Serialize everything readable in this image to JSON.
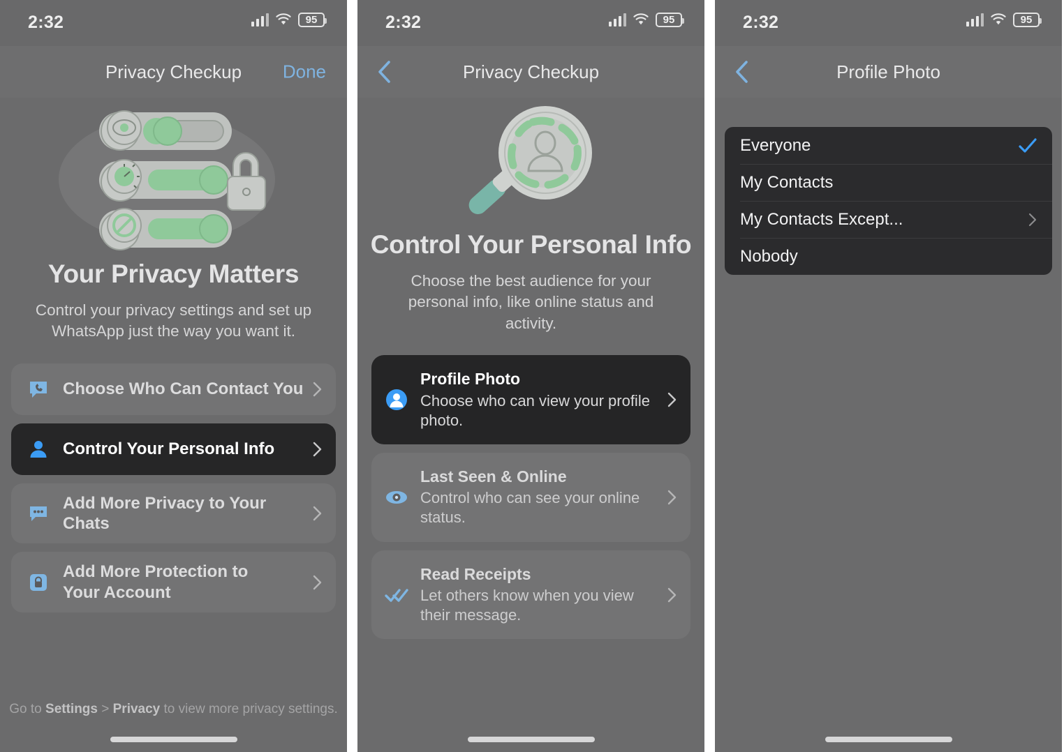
{
  "status_bar": {
    "time": "2:32",
    "battery_level": "95",
    "cellular_icon": "cellular-bars-icon",
    "wifi_icon": "wifi-icon",
    "battery_icon": "battery-icon"
  },
  "colors": {
    "screen_background": "#6b6b6c",
    "card_highlight": "#262627",
    "accent_blue": "#3b9cf5",
    "nav_link_blue": "#7fb3e0",
    "illustration_green": "#8fc99a"
  },
  "panel1": {
    "nav": {
      "title": "Privacy Checkup",
      "done_label": "Done"
    },
    "illustration": "privacy-toggles-lock-illustration",
    "hero_title": "Your Privacy Matters",
    "hero_subtitle": "Control your privacy settings and set up WhatsApp just the way you want it.",
    "items": [
      {
        "label": "Choose Who Can Contact You",
        "icon": "phone-bubble-icon",
        "active": false
      },
      {
        "label": "Control Your Personal Info",
        "icon": "person-icon",
        "active": true
      },
      {
        "label": "Add More Privacy to Your Chats",
        "icon": "chat-bubble-icon",
        "active": false
      },
      {
        "label": "Add More Protection to Your Account",
        "icon": "lock-square-icon",
        "active": false
      }
    ],
    "footnote_prefix": "Go to ",
    "footnote_bold1": "Settings",
    "footnote_mid": " > ",
    "footnote_bold2": "Privacy",
    "footnote_suffix": " to view more privacy settings."
  },
  "panel2": {
    "nav": {
      "title": "Privacy Checkup",
      "back_icon": "chevron-left-icon"
    },
    "illustration": "magnifier-person-illustration",
    "hero_title": "Control Your Personal Info",
    "hero_subtitle": "Choose the best audience for your personal info, like online status and activity.",
    "cards": [
      {
        "title": "Profile Photo",
        "desc": "Choose who can view your profile photo.",
        "icon": "person-circle-icon",
        "active": true
      },
      {
        "title": "Last Seen & Online",
        "desc": "Control who can see your online status.",
        "icon": "eye-icon",
        "active": false
      },
      {
        "title": "Read Receipts",
        "desc": "Let others know when you view their message.",
        "icon": "double-check-icon",
        "active": false
      }
    ]
  },
  "panel3": {
    "nav": {
      "title": "Profile Photo",
      "back_icon": "chevron-left-icon"
    },
    "options": [
      {
        "label": "Everyone",
        "selected": true,
        "has_chevron": false
      },
      {
        "label": "My Contacts",
        "selected": false,
        "has_chevron": false
      },
      {
        "label": "My Contacts Except...",
        "selected": false,
        "has_chevron": true
      },
      {
        "label": "Nobody",
        "selected": false,
        "has_chevron": false
      }
    ]
  }
}
